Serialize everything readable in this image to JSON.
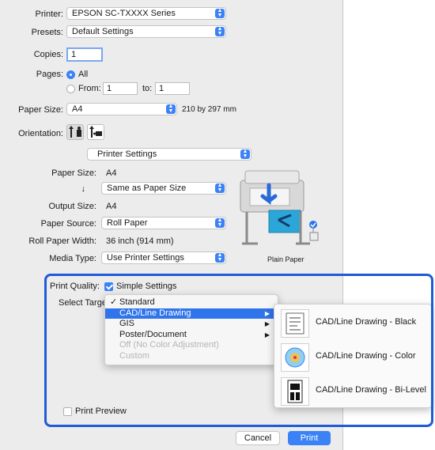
{
  "printer": {
    "label": "Printer:",
    "value": "EPSON SC-TXXXX Series"
  },
  "presets": {
    "label": "Presets:",
    "value": "Default Settings"
  },
  "copies": {
    "label": "Copies:",
    "value": "1"
  },
  "pages": {
    "label": "Pages:",
    "all_label": "All",
    "from_label": "From:",
    "from_value": "1",
    "to_label": "to:",
    "to_value": "1"
  },
  "paper_size": {
    "label": "Paper Size:",
    "value": "A4",
    "dimensions": "210 by 297 mm"
  },
  "orientation": {
    "label": "Orientation:"
  },
  "section_menu": {
    "value": "Printer Settings"
  },
  "settings": {
    "paper_size_label": "Paper Size:",
    "paper_size_value": "A4",
    "arrow_down": "↓",
    "same_as_value": "Same as Paper Size",
    "output_size_label": "Output Size:",
    "output_size_value": "A4",
    "paper_source_label": "Paper Source:",
    "paper_source_value": "Roll Paper",
    "roll_width_label": "Roll Paper Width:",
    "roll_width_value": "36 inch (914 mm)",
    "media_type_label": "Media Type:",
    "media_type_value": "Use Printer Settings",
    "preview_caption": "Plain Paper"
  },
  "print_quality": {
    "label": "Print Quality:",
    "checkbox_label": "Simple Settings"
  },
  "select_target": {
    "label": "Select Target",
    "menu": [
      {
        "label": "Standard",
        "checked": true,
        "submenu": false,
        "disabled": false
      },
      {
        "label": "CAD/Line Drawing",
        "checked": false,
        "submenu": true,
        "disabled": false
      },
      {
        "label": "GIS",
        "checked": false,
        "submenu": true,
        "disabled": false
      },
      {
        "label": "Poster/Document",
        "checked": false,
        "submenu": true,
        "disabled": false
      },
      {
        "label": "Off (No Color Adjustment)",
        "checked": false,
        "submenu": false,
        "disabled": true
      },
      {
        "label": "Custom",
        "checked": false,
        "submenu": false,
        "disabled": true
      }
    ],
    "check_mark": "✓",
    "submenu_arrow": "▶",
    "submenu": [
      {
        "label": "CAD/Line Drawing - Black"
      },
      {
        "label": "CAD/Line Drawing - Color"
      },
      {
        "label": "CAD/Line Drawing - Bi-Level"
      }
    ]
  },
  "print_preview": {
    "label": "Print Preview"
  },
  "buttons": {
    "cancel": "Cancel",
    "print": "Print"
  },
  "colors": {
    "accent": "#3b82f6",
    "highlight_frame": "#1f5bd6",
    "menu_highlight": "#2f74ea"
  }
}
